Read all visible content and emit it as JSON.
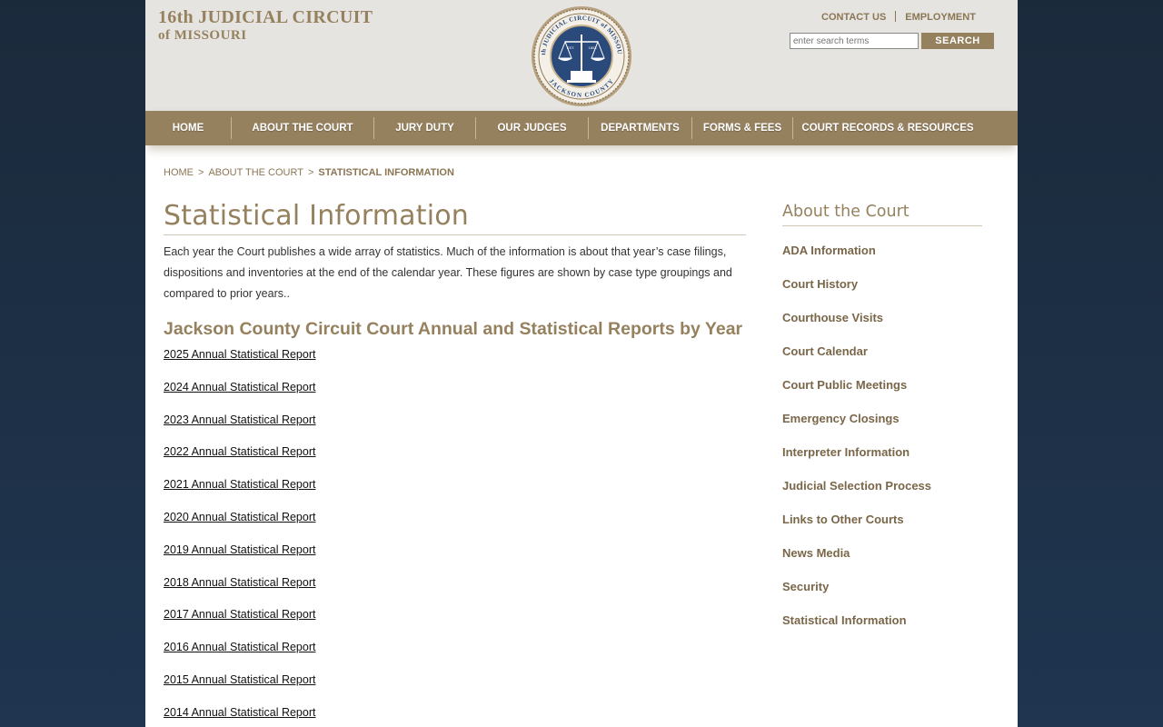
{
  "header": {
    "brand_line1": "16th JUDICIAL CIRCUIT",
    "brand_line2": "of MISSOURI",
    "seal": {
      "top_text": "16th JUDICIAL CIRCUIT of MISSOURI",
      "bottom_text": "JACKSON COUNTY",
      "est": "EST.",
      "year": "1803"
    },
    "contact_label": "CONTACT US",
    "employment_label": "EMPLOYMENT",
    "search_placeholder": "enter search terms",
    "search_button": "SEARCH"
  },
  "nav": {
    "items": [
      "HOME",
      "ABOUT THE COURT",
      "JURY DUTY",
      "OUR JUDGES",
      "DEPARTMENTS",
      "FORMS & FEES",
      "COURT RECORDS & RESOURCES"
    ]
  },
  "breadcrumb": {
    "items": [
      "HOME",
      "ABOUT THE COURT"
    ],
    "separator": ">",
    "current": "STATISTICAL INFORMATION"
  },
  "main": {
    "title": "Statistical Information",
    "intro": "Each year the Court publishes a wide array of statistics.  Much of the information is about that year’s case filings, dispositions and inventories at the end of the calendar year.  These figures are shown by  case type groupings and compared to prior years..",
    "reports_heading": "Jackson County Circuit Court Annual and Statistical Reports by Year",
    "reports": [
      "2025 Annual Statistical Report",
      "2024 Annual Statistical Report",
      "2023 Annual Statistical Report",
      "2022 Annual Statistical Report",
      "2021 Annual Statistical Report",
      "2020 Annual Statistical Report",
      "2019 Annual Statistical Report",
      "2018 Annual Statistical Report",
      "2017 Annual Statistical Report",
      "2016 Annual Statistical Report",
      "2015 Annual Statistical Report",
      "2014 Annual Statistical Report"
    ]
  },
  "sidebar": {
    "title": "About the Court",
    "items": [
      "ADA Information",
      "Court History",
      "Courthouse Visits",
      "Court Calendar",
      "Court Public Meetings",
      "Emergency Closings",
      "Interpreter Information",
      "Judicial Selection Process",
      "Links to Other Courts",
      "News Media",
      "Security",
      "Statistical Information"
    ]
  },
  "colors": {
    "accent": "#96815f",
    "header_bg": "#e6e4e1",
    "seal_blue": "#2a4a7c",
    "page_bg": "#1f3550"
  }
}
